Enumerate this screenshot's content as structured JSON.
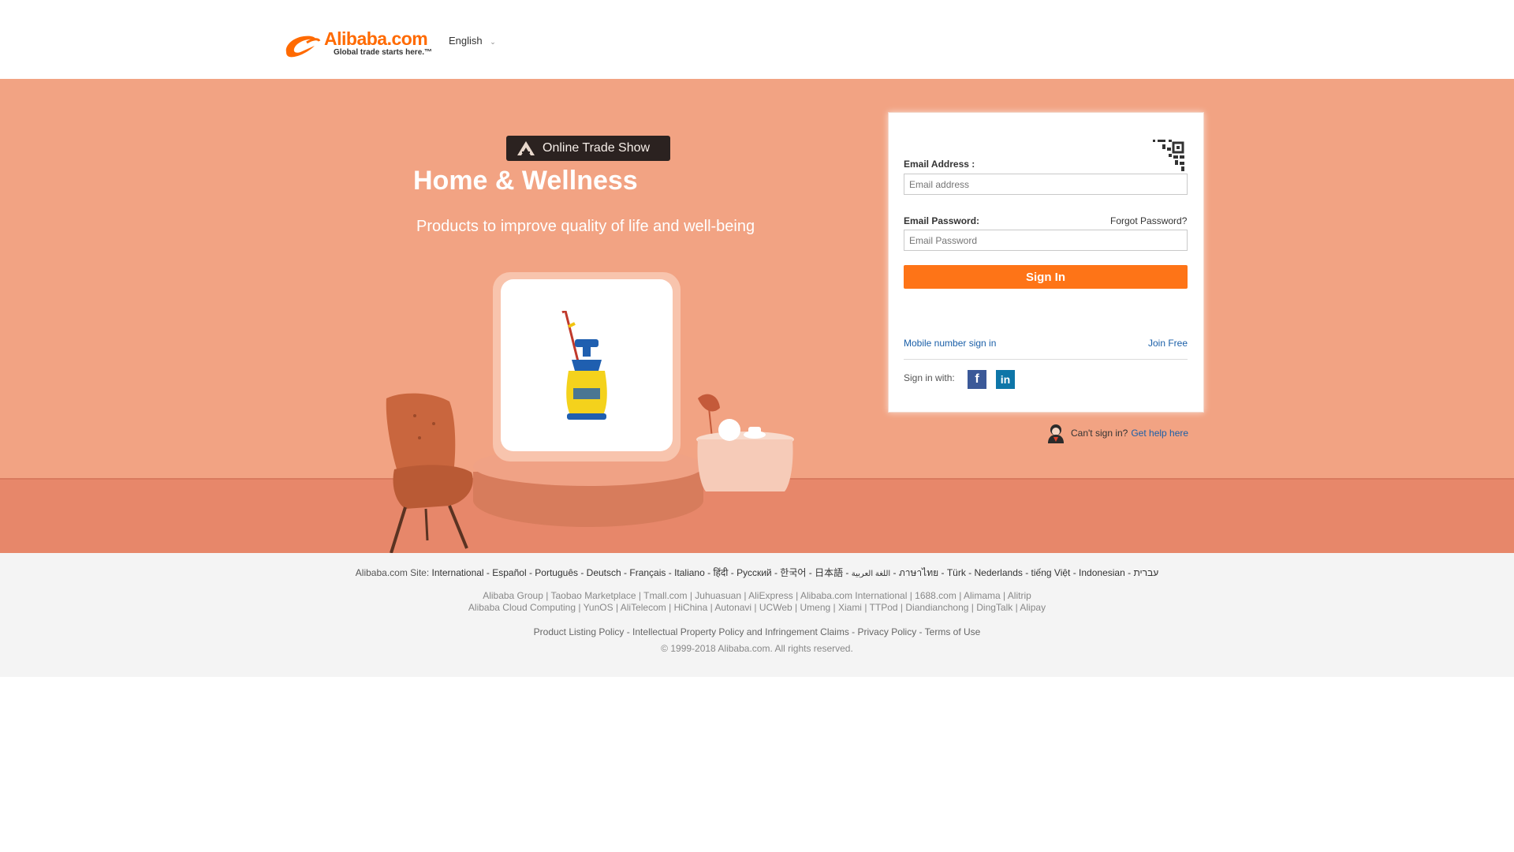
{
  "header": {
    "logo_word": "Alibaba.com",
    "logo_tagline": "Global trade starts here.™",
    "language": "English"
  },
  "hero": {
    "badge": "Online Trade Show",
    "title": "Home & Wellness",
    "subtitle": "Products to improve quality of life and well-being"
  },
  "login": {
    "email_label": "Email Address :",
    "email_placeholder": "Email address",
    "password_label": "Email Password:",
    "password_placeholder": "Email Password",
    "forgot": "Forgot Password?",
    "sign_in": "Sign In",
    "mobile_sign_in": "Mobile number sign in",
    "join_free": "Join Free",
    "sign_in_with": "Sign in with:",
    "help_text": "Can't sign in?",
    "help_link": "Get help here"
  },
  "footer": {
    "sites_label": "Alibaba.com Site:",
    "sites": [
      "International",
      "Español",
      "Português",
      "Deutsch",
      "Français",
      "Italiano",
      "हिंदी",
      "Русский",
      "한국어",
      "日本語",
      "اللغة العربية",
      "ภาษาไทย",
      "Türk",
      "Nederlands",
      "tiếng Việt",
      "Indonesian",
      "עברית"
    ],
    "group_row1": [
      "Alibaba Group",
      "Taobao Marketplace",
      "Tmall.com",
      "Juhuasuan",
      "AliExpress",
      "Alibaba.com International",
      "1688.com",
      "Alimama",
      "Alitrip"
    ],
    "group_row2": [
      "Alibaba Cloud Computing",
      "YunOS",
      "AliTelecom",
      "HiChina",
      "Autonavi",
      "UCWeb",
      "Umeng",
      "Xiami",
      "TTPod",
      "Diandianchong",
      "DingTalk",
      "Alipay"
    ],
    "policies": [
      "Product Listing Policy",
      "Intellectual Property Policy and Infringement Claims",
      "Privacy Policy",
      "Terms of Use"
    ],
    "copyright": "© 1999-2018 Alibaba.com. All rights reserved."
  },
  "colors": {
    "brand_orange": "#ff6a00",
    "signin_button": "#fe7417",
    "hero_bg": "#f2a383",
    "link_blue": "#1a5fa8"
  },
  "icons": [
    "qr-code-icon",
    "facebook-icon",
    "linkedin-icon",
    "help-support-icon",
    "chevron-down-icon"
  ]
}
